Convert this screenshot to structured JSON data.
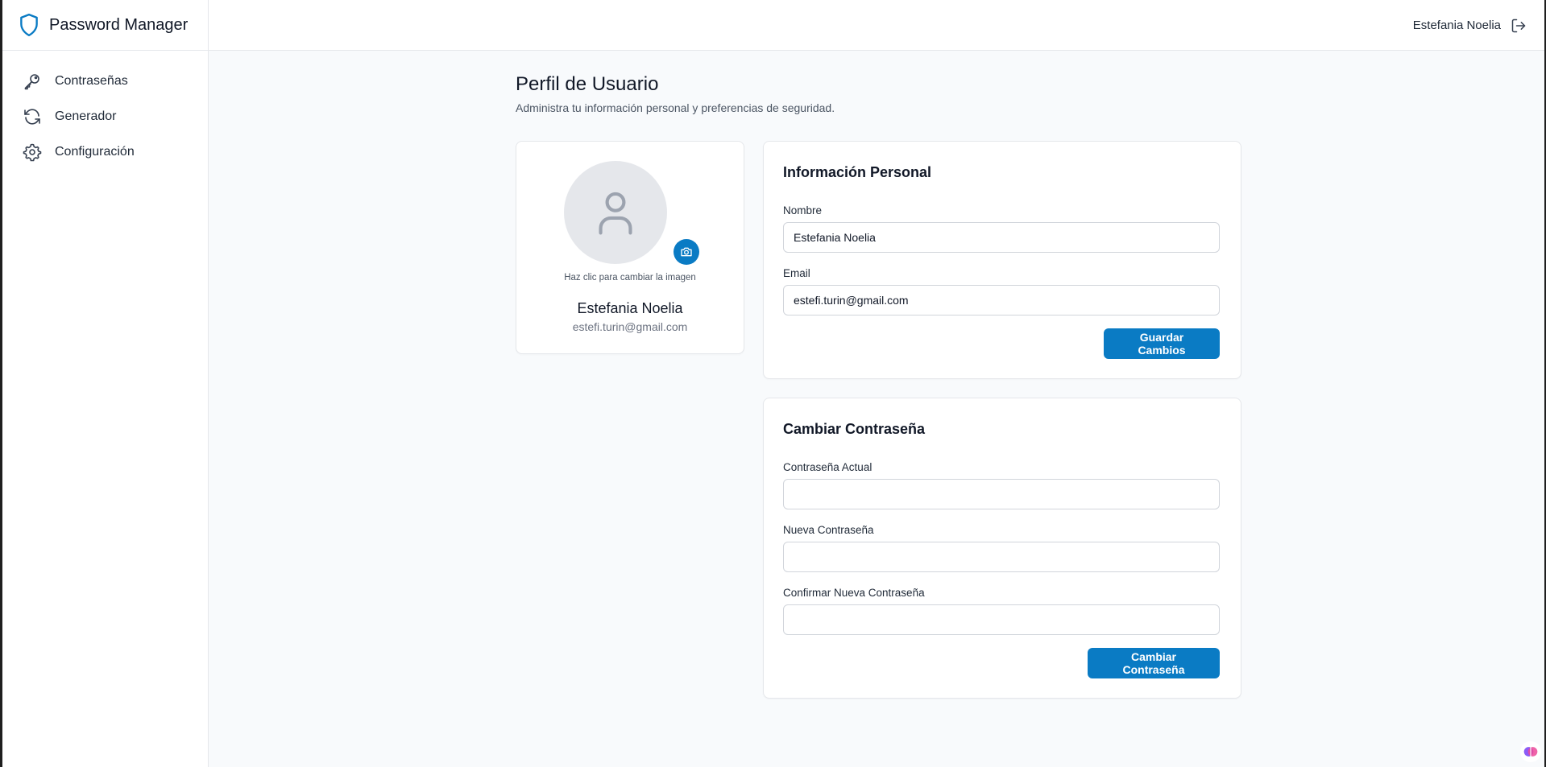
{
  "app": {
    "title": "Password Manager"
  },
  "sidebar": {
    "items": [
      {
        "label": "Contraseñas",
        "icon": "key-icon"
      },
      {
        "label": "Generador",
        "icon": "refresh-icon"
      },
      {
        "label": "Configuración",
        "icon": "gear-icon"
      }
    ]
  },
  "topbar": {
    "user_name": "Estefania Noelia",
    "logout_icon": "logout-icon"
  },
  "page": {
    "title": "Perfil de Usuario",
    "subtitle": "Administra tu información personal y preferencias de seguridad."
  },
  "profile": {
    "hint": "Haz clic para cambiar la imagen",
    "name": "Estefania Noelia",
    "email": "estefi.turin@gmail.com"
  },
  "personal_info": {
    "title": "Información Personal",
    "name_label": "Nombre",
    "name_value": "Estefania Noelia",
    "email_label": "Email",
    "email_value": "estefi.turin@gmail.com",
    "save_label": "Guardar Cambios"
  },
  "change_password": {
    "title": "Cambiar Contraseña",
    "current_label": "Contraseña Actual",
    "current_value": "",
    "new_label": "Nueva Contraseña",
    "new_value": "",
    "confirm_label": "Confirmar Nueva Contraseña",
    "confirm_value": "",
    "submit_label": "Cambiar Contraseña"
  },
  "colors": {
    "accent": "#0a7bc4",
    "background": "#f8fafc",
    "border": "#e5e7eb"
  }
}
